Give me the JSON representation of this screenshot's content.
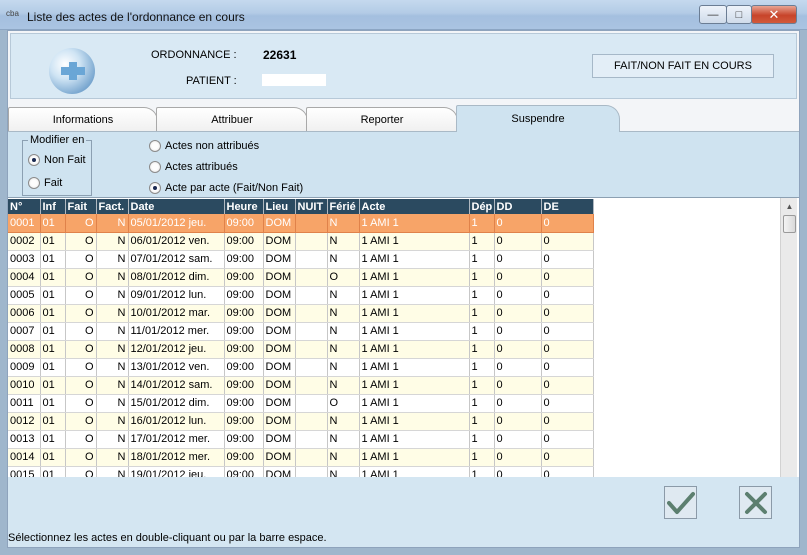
{
  "window": {
    "app_icon": "cba",
    "title": "Liste des actes de l'ordonnance en cours",
    "minimize_icon": "minimize-icon",
    "maximize_icon": "maximize-icon",
    "close_icon": "close-icon"
  },
  "header": {
    "ordonnance_label": "ORDONNANCE :",
    "ordonnance_value": "22631",
    "patient_label": "PATIENT :",
    "patient_value": "",
    "status_button": "FAIT/NON FAIT  EN COURS"
  },
  "tabs": [
    {
      "label": "Informations"
    },
    {
      "label": "Attribuer"
    },
    {
      "label": "Reporter"
    },
    {
      "label": "Suspendre",
      "active": true
    }
  ],
  "options": {
    "group_title": "Modifier en",
    "mode": [
      {
        "label": "Non Fait",
        "checked": true
      },
      {
        "label": "Fait",
        "checked": false
      }
    ],
    "filter": [
      {
        "label": "Actes non attribués",
        "checked": false
      },
      {
        "label": "Actes attribués",
        "checked": false
      },
      {
        "label": "Acte par acte (Fait/Non Fait)",
        "checked": true
      }
    ]
  },
  "grid": {
    "columns": [
      "N°",
      "Inf",
      "Fait",
      "Fact.",
      "Date",
      "Heure",
      "Lieu",
      "NUIT",
      "Férié",
      "Acte",
      "Dép",
      "DD",
      "DE"
    ],
    "rows": [
      [
        "0001",
        "01",
        "O",
        "N",
        "05/01/2012 jeu.",
        "09:00",
        "DOM",
        "",
        "N",
        "1  AMI   1",
        "1",
        "0",
        "0"
      ],
      [
        "0002",
        "01",
        "O",
        "N",
        "06/01/2012 ven.",
        "09:00",
        "DOM",
        "",
        "N",
        "1  AMI   1",
        "1",
        "0",
        "0"
      ],
      [
        "0003",
        "01",
        "O",
        "N",
        "07/01/2012 sam.",
        "09:00",
        "DOM",
        "",
        "N",
        "1  AMI   1",
        "1",
        "0",
        "0"
      ],
      [
        "0004",
        "01",
        "O",
        "N",
        "08/01/2012 dim.",
        "09:00",
        "DOM",
        "",
        "O",
        "1  AMI   1",
        "1",
        "0",
        "0"
      ],
      [
        "0005",
        "01",
        "O",
        "N",
        "09/01/2012 lun.",
        "09:00",
        "DOM",
        "",
        "N",
        "1  AMI   1",
        "1",
        "0",
        "0"
      ],
      [
        "0006",
        "01",
        "O",
        "N",
        "10/01/2012 mar.",
        "09:00",
        "DOM",
        "",
        "N",
        "1  AMI   1",
        "1",
        "0",
        "0"
      ],
      [
        "0007",
        "01",
        "O",
        "N",
        "11/01/2012 mer.",
        "09:00",
        "DOM",
        "",
        "N",
        "1  AMI   1",
        "1",
        "0",
        "0"
      ],
      [
        "0008",
        "01",
        "O",
        "N",
        "12/01/2012 jeu.",
        "09:00",
        "DOM",
        "",
        "N",
        "1  AMI   1",
        "1",
        "0",
        "0"
      ],
      [
        "0009",
        "01",
        "O",
        "N",
        "13/01/2012 ven.",
        "09:00",
        "DOM",
        "",
        "N",
        "1  AMI   1",
        "1",
        "0",
        "0"
      ],
      [
        "0010",
        "01",
        "O",
        "N",
        "14/01/2012 sam.",
        "09:00",
        "DOM",
        "",
        "N",
        "1  AMI   1",
        "1",
        "0",
        "0"
      ],
      [
        "0011",
        "01",
        "O",
        "N",
        "15/01/2012 dim.",
        "09:00",
        "DOM",
        "",
        "O",
        "1  AMI   1",
        "1",
        "0",
        "0"
      ],
      [
        "0012",
        "01",
        "O",
        "N",
        "16/01/2012 lun.",
        "09:00",
        "DOM",
        "",
        "N",
        "1  AMI   1",
        "1",
        "0",
        "0"
      ],
      [
        "0013",
        "01",
        "O",
        "N",
        "17/01/2012 mer.",
        "09:00",
        "DOM",
        "",
        "N",
        "1  AMI   1",
        "1",
        "0",
        "0"
      ],
      [
        "0014",
        "01",
        "O",
        "N",
        "18/01/2012 mer.",
        "09:00",
        "DOM",
        "",
        "N",
        "1  AMI   1",
        "1",
        "0",
        "0"
      ],
      [
        "0015",
        "01",
        "O",
        "N",
        "19/01/2012 jeu.",
        "09:00",
        "DOM",
        "",
        "N",
        "1  AMI   1",
        "1",
        "0",
        "0"
      ]
    ],
    "selected_row": 0
  },
  "footer": {
    "ok_icon": "check-icon",
    "cancel_icon": "cross-icon",
    "status": "Sélectionnez les actes en double-cliquant ou par la barre espace."
  },
  "colors": {
    "header_bg": "#2b4a60",
    "selected_row": "#f7a468",
    "alt_row": "#fffde6",
    "panel_bg": "#cfe3f0"
  }
}
